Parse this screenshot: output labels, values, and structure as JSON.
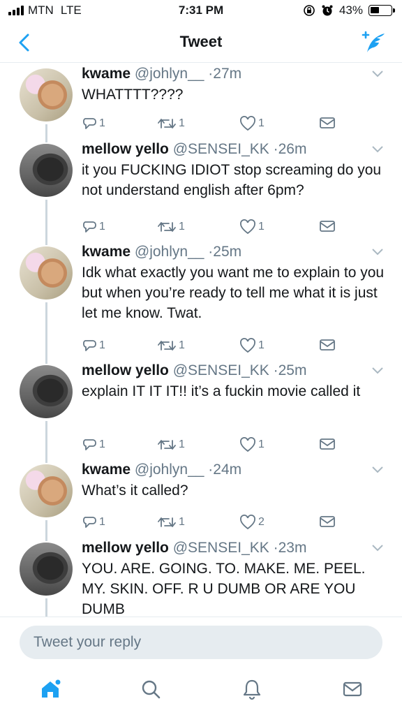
{
  "status_bar": {
    "carrier": "MTN",
    "network": "LTE",
    "time": "7:31 PM",
    "battery": "43%",
    "battery_level": 0.43
  },
  "nav": {
    "title": "Tweet"
  },
  "thread": [
    {
      "name": "kwame",
      "handle": "@johlyn__",
      "time": "27m",
      "text": "WHATTTT????",
      "replies": "1",
      "retweets": "1",
      "likes": "1"
    },
    {
      "name": "mellow yello",
      "handle": "@SENSEI_KK",
      "time": "26m",
      "text": "it you FUCKING IDIOT stop screaming do you not understand english after 6pm?",
      "replies": "1",
      "retweets": "1",
      "likes": "1"
    },
    {
      "name": "kwame",
      "handle": "@johlyn__",
      "time": "25m",
      "text": "Idk what exactly you want me to explain to you but when you’re ready to tell me what it is just let me know. Twat.",
      "replies": "1",
      "retweets": "1",
      "likes": "1"
    },
    {
      "name": "mellow yello",
      "handle": "@SENSEI_KK",
      "time": "25m",
      "text": "explain IT IT IT!! it’s a fuckin movie called it",
      "replies": "1",
      "retweets": "1",
      "likes": "1"
    },
    {
      "name": "kwame",
      "handle": "@johlyn__",
      "time": "24m",
      "text": "What’s it called?",
      "replies": "1",
      "retweets": "1",
      "likes": "2"
    },
    {
      "name": "mellow yello",
      "handle": "@SENSEI_KK",
      "time": "23m",
      "text": "YOU. ARE. GOING. TO. MAKE. ME. PEEL. MY. SKIN. OFF. R U DUMB OR ARE YOU DUMB",
      "replies": "",
      "retweets": "",
      "likes": ""
    }
  ],
  "reply": {
    "placeholder": "Tweet your reply"
  },
  "tabs": [
    {
      "icon": "home-icon",
      "active": true
    },
    {
      "icon": "search-icon",
      "active": false
    },
    {
      "icon": "bell-icon",
      "active": false
    },
    {
      "icon": "mail-icon",
      "active": false
    }
  ],
  "colors": {
    "accent": "#1da1f2",
    "secondary_text": "#657786",
    "divider": "#e6ecf0"
  }
}
